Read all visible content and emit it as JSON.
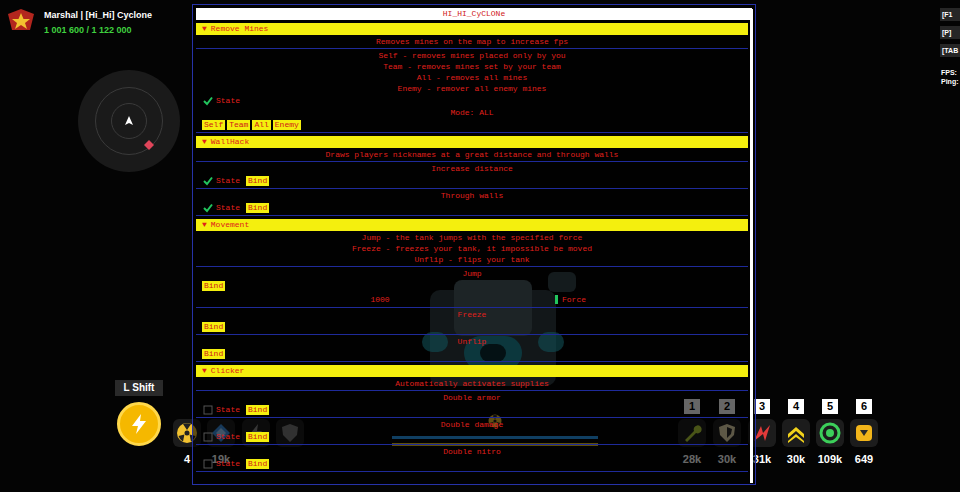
{
  "player": {
    "rank": "Marshal | [Hi_Hi] Cyclone",
    "score": "1 001 600 / 1 122 000"
  },
  "hotkeys": [
    "[F1",
    "[P]",
    "[TAB"
  ],
  "stats": [
    "FPS:",
    "Ping:"
  ],
  "menu": {
    "title": "HI_HI_CyCLONe",
    "sections": [
      {
        "arrow": "▼",
        "title": "Remove Mines",
        "expanded": true,
        "blocks": [
          {
            "rows": [
              {
                "kind": "text",
                "text": "Removes mines on the map to increase fps"
              }
            ]
          },
          {
            "rows": [
              {
                "kind": "text",
                "text": "Self - removes mines placed only by you"
              },
              {
                "kind": "text",
                "text": "Team - removes mines set by your team"
              },
              {
                "kind": "text",
                "text": "All - removes all mines"
              },
              {
                "kind": "text",
                "text": "Enemy - remover all enemy mines"
              },
              {
                "kind": "toggle",
                "label": "State",
                "checked": true
              },
              {
                "kind": "text",
                "text": "Mode: ALL"
              },
              {
                "kind": "buttons",
                "buttons": [
                  "Self",
                  "Team",
                  "All",
                  "Enemy"
                ]
              }
            ]
          }
        ]
      },
      {
        "arrow": "▼",
        "title": "WallHack",
        "expanded": true,
        "blocks": [
          {
            "rows": [
              {
                "kind": "text",
                "text": "Draws players nicknames at a great distance and through walls"
              }
            ]
          },
          {
            "rows": [
              {
                "kind": "text",
                "text": "Increase distance"
              },
              {
                "kind": "toggle",
                "label": "State",
                "checked": true,
                "bind": "Bind"
              }
            ]
          },
          {
            "rows": [
              {
                "kind": "text",
                "text": "Through walls"
              },
              {
                "kind": "toggle",
                "label": "State",
                "checked": true,
                "bind": "Bind"
              }
            ]
          }
        ]
      },
      {
        "arrow": "▼",
        "title": "Movement",
        "expanded": true,
        "blocks": [
          {
            "rows": [
              {
                "kind": "text",
                "text": "Jump - the tank jumps with the specified force"
              },
              {
                "kind": "text",
                "text": "Freeze - freezes your tank, it impossible be moved"
              },
              {
                "kind": "text",
                "text": "Unflip - flips your tank"
              }
            ]
          },
          {
            "rows": [
              {
                "kind": "text",
                "text": "Jump"
              },
              {
                "kind": "bind",
                "label": "Bind"
              },
              {
                "kind": "slider",
                "value": "1000",
                "label": "Force",
                "level": 1
              }
            ]
          },
          {
            "rows": [
              {
                "kind": "text",
                "text": "Freeze"
              },
              {
                "kind": "bind",
                "label": "Bind"
              }
            ]
          },
          {
            "rows": [
              {
                "kind": "text",
                "text": "Unflip"
              },
              {
                "kind": "bind",
                "label": "Bind"
              }
            ]
          }
        ]
      },
      {
        "arrow": "▼",
        "title": "Clicker",
        "expanded": true,
        "blocks": [
          {
            "rows": [
              {
                "kind": "text",
                "text": "Automatically activates supplies"
              }
            ]
          },
          {
            "rows": [
              {
                "kind": "text",
                "text": "Double armor"
              },
              {
                "kind": "toggle",
                "label": "State",
                "checked": false,
                "bind": "Bind"
              }
            ]
          },
          {
            "rows": [
              {
                "kind": "text",
                "text": "Double damage"
              },
              {
                "kind": "toggle",
                "label": "State",
                "checked": false,
                "bind": "Bind"
              }
            ]
          },
          {
            "rows": [
              {
                "kind": "text",
                "text": "Double nitro"
              },
              {
                "kind": "toggle",
                "label": "State",
                "checked": false,
                "bind": "Bind"
              }
            ]
          }
        ]
      }
    ]
  },
  "ability": {
    "key": "L Shift"
  },
  "left_slots": [
    {
      "count": "4"
    },
    {
      "count": "19k"
    },
    {},
    {}
  ],
  "bars": [
    {
      "level": 1,
      "color": "#2a9df4"
    },
    {
      "level": 1,
      "color": "#e8c21a"
    }
  ],
  "right_slots": [
    {
      "key": "1",
      "count": "28k"
    },
    {
      "key": "2",
      "count": "30k"
    },
    {
      "key": "3",
      "count": "31k"
    },
    {
      "key": "4",
      "count": "30k"
    },
    {
      "key": "5",
      "count": "109k"
    },
    {
      "key": "6",
      "count": "649"
    }
  ]
}
